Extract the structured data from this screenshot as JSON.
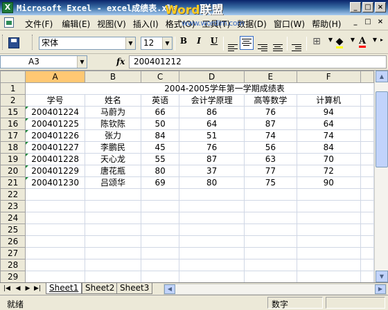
{
  "window": {
    "title": "Microsoft Excel - excel成绩表.xls",
    "watermark_word": "Word",
    "watermark_lian": "联盟",
    "watermark_url": "www.wordlm.com",
    "buttons": [
      "_",
      "□",
      "×"
    ]
  },
  "menu": {
    "items": [
      "文件(F)",
      "编辑(E)",
      "视图(V)",
      "插入(I)",
      "格式(O)",
      "工具(T)",
      "数据(D)",
      "窗口(W)",
      "帮助(H)"
    ],
    "right_buttons": [
      "_",
      "□",
      "×"
    ]
  },
  "toolbar": {
    "font": "宋体",
    "size": "12",
    "bold": "B",
    "italic": "I",
    "underline": "U",
    "font_color_letter": "A"
  },
  "formula_bar": {
    "cell_ref": "A3",
    "fx": "fx",
    "value": "200401212"
  },
  "grid": {
    "columns": [
      "A",
      "B",
      "C",
      "D",
      "E",
      "F"
    ],
    "selected_column": "A",
    "title_row": {
      "row": "1",
      "text": "2004-2005学年第一学期成绩表"
    },
    "header_row": {
      "row": "2",
      "cells": [
        "学号",
        "姓名",
        "英语",
        "会计学原理",
        "高等数学",
        "计算机"
      ]
    },
    "data_rows": [
      {
        "row": "15",
        "cells": [
          "200401224",
          "马蔚为",
          "66",
          "86",
          "76",
          "94"
        ]
      },
      {
        "row": "16",
        "cells": [
          "200401225",
          "陈钦陈",
          "50",
          "64",
          "87",
          "64"
        ]
      },
      {
        "row": "17",
        "cells": [
          "200401226",
          "张力",
          "84",
          "51",
          "74",
          "74"
        ]
      },
      {
        "row": "18",
        "cells": [
          "200401227",
          "李鹏民",
          "45",
          "76",
          "56",
          "84"
        ]
      },
      {
        "row": "19",
        "cells": [
          "200401228",
          "天心龙",
          "55",
          "87",
          "63",
          "70"
        ]
      },
      {
        "row": "20",
        "cells": [
          "200401229",
          "唐花瓶",
          "80",
          "37",
          "77",
          "72"
        ]
      },
      {
        "row": "21",
        "cells": [
          "200401230",
          "吕颂华",
          "69",
          "80",
          "75",
          "90"
        ]
      }
    ],
    "empty_rows": [
      "22",
      "23",
      "24",
      "25",
      "26",
      "27",
      "28",
      "29"
    ]
  },
  "sheets": {
    "tabs": [
      "Sheet1",
      "Sheet2",
      "Sheet3"
    ],
    "active": "Sheet1"
  },
  "status": {
    "left": "就绪",
    "mode": "数字"
  }
}
